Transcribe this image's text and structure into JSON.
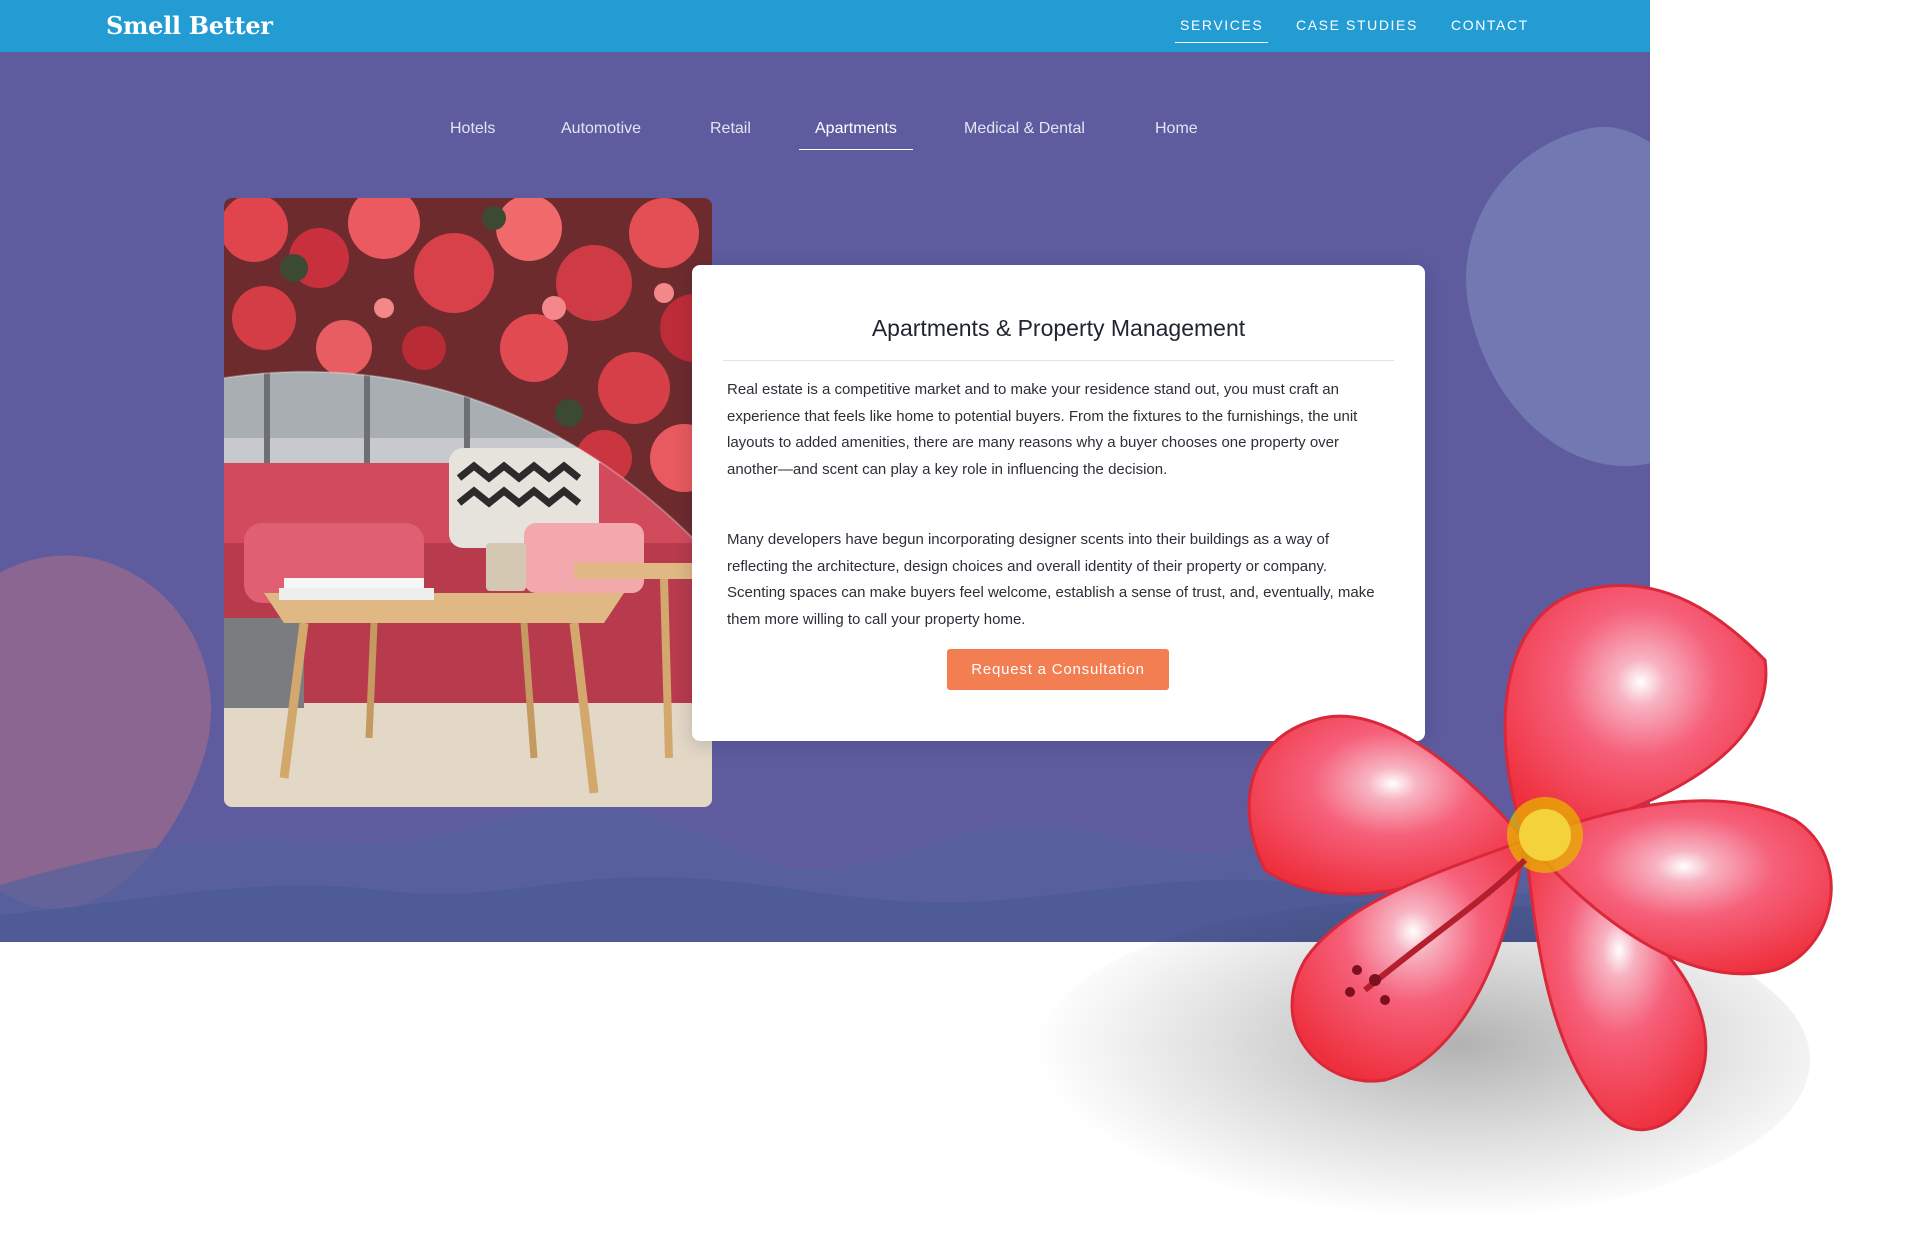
{
  "brand": {
    "logo": "Smell Better"
  },
  "main_nav": [
    {
      "label": "SERVICES",
      "active": true
    },
    {
      "label": "CASE STUDIES",
      "active": false
    },
    {
      "label": "CONTACT",
      "active": false
    }
  ],
  "sub_nav": [
    {
      "label": "Hotels",
      "active": false
    },
    {
      "label": "Automotive",
      "active": false
    },
    {
      "label": "Retail",
      "active": false
    },
    {
      "label": "Apartments",
      "active": true
    },
    {
      "label": "Medical & Dental",
      "active": false
    },
    {
      "label": "Home",
      "active": false
    }
  ],
  "card": {
    "title": "Apartments & Property Management",
    "paragraph_1": "Real estate is a competitive market and to make your residence stand out, you must craft an experience that feels like home to potential buyers. From the fixtures to the furnishings, the unit layouts to added amenities, there are many reasons why a buyer chooses one property over another—and scent can play a key role in influencing the decision.",
    "paragraph_2": "Many developers have begun incorporating designer scents into their buildings as a way of reflecting the architecture, design choices and overall identity of their property or company. Scenting spaces can make buyers feel welcome, establish a sense of trust, and, eventually, make them more willing to call your property home.",
    "cta_label": "Request a Consultation"
  },
  "colors": {
    "topbar": "#239bd3",
    "hero_background": "#5e5c9f",
    "cta": "#f27e52",
    "flower": "#f5576a"
  },
  "images": {
    "photo": "begonia-flowers-and-living-room-collage",
    "decoration": "hibiscus-flower"
  }
}
